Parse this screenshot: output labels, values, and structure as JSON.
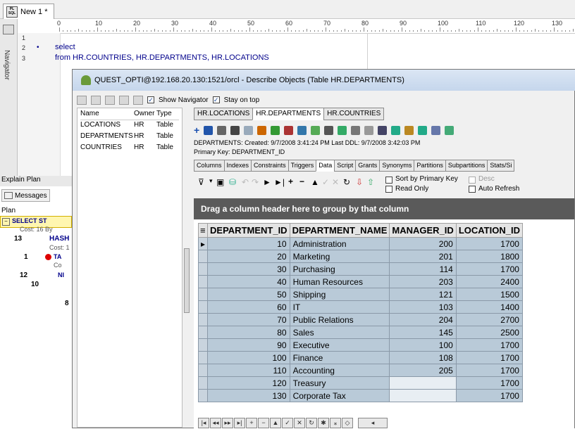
{
  "document_tab": {
    "title": "New 1 *",
    "icon": "plsql-file-icon"
  },
  "navigator_label": "Navigator",
  "ruler_numbers": [
    "0",
    "10",
    "20",
    "30",
    "40",
    "50",
    "60",
    "70",
    "80",
    "90",
    "100",
    "110",
    "120",
    "130"
  ],
  "editor": {
    "lines": [
      {
        "num": "1",
        "text": ""
      },
      {
        "num": "2",
        "text": "select"
      },
      {
        "num": "3",
        "text": "from HR.COUNTRIES, HR.DEPARTMENTS, HR.LOCATIONS"
      }
    ]
  },
  "explain_plan": {
    "title": "Explain Plan",
    "messages_tab": "Messages",
    "plan_label": "Plan",
    "rows": [
      "SELECT ST",
      "Cost: 16 By",
      "HASH",
      "Cost: 1",
      "TA",
      "Co",
      "NI"
    ],
    "numbers": [
      "13",
      "1",
      "12",
      "10",
      "8"
    ]
  },
  "dialog": {
    "title": "QUEST_OPTI@192.168.20.130:1521/orcl - Describe Objects (Table HR.DEPARTMENTS)",
    "show_navigator": "Show Navigator",
    "stay_on_top": "Stay on top",
    "object_list": {
      "headers": [
        "Name",
        "Owner",
        "Type"
      ],
      "rows": [
        [
          "LOCATIONS",
          "HR",
          "Table"
        ],
        [
          "DEPARTMENTS",
          "HR",
          "Table"
        ],
        [
          "COUNTRIES",
          "HR",
          "Table"
        ]
      ]
    },
    "object_tabs": [
      "HR.LOCATIONS",
      "HR.DEPARTMENTS",
      "HR.COUNTRIES"
    ],
    "active_object_tab": 1,
    "info_line": "DEPARTMENTS:  Created: 9/7/2008 3:41:24 PM   Last DDL: 9/7/2008 3:42:03 PM",
    "primary_key_line": "Primary Key:  DEPARTMENT_ID",
    "sub_tabs": [
      "Columns",
      "Indexes",
      "Constraints",
      "Triggers",
      "Data",
      "Script",
      "Grants",
      "Synonyms",
      "Partitions",
      "Subpartitions",
      "Stats/Si"
    ],
    "active_sub_tab": 4,
    "options": {
      "sort_by_pk": "Sort by Primary Key",
      "read_only": "Read Only",
      "desc": "Desc",
      "auto_refresh": "Auto Refresh"
    },
    "group_header": "Drag a column header here to group by that column",
    "grid": {
      "columns": [
        "DEPARTMENT_ID",
        "DEPARTMENT_NAME",
        "MANAGER_ID",
        "LOCATION_ID"
      ],
      "rows": [
        [
          "10",
          "Administration",
          "200",
          "1700"
        ],
        [
          "20",
          "Marketing",
          "201",
          "1800"
        ],
        [
          "30",
          "Purchasing",
          "114",
          "1700"
        ],
        [
          "40",
          "Human Resources",
          "203",
          "2400"
        ],
        [
          "50",
          "Shipping",
          "121",
          "1500"
        ],
        [
          "60",
          "IT",
          "103",
          "1400"
        ],
        [
          "70",
          "Public Relations",
          "204",
          "2700"
        ],
        [
          "80",
          "Sales",
          "145",
          "2500"
        ],
        [
          "90",
          "Executive",
          "100",
          "1700"
        ],
        [
          "100",
          "Finance",
          "108",
          "1700"
        ],
        [
          "110",
          "Accounting",
          "205",
          "1700"
        ],
        [
          "120",
          "Treasury",
          "",
          "1700"
        ],
        [
          "130",
          "Corporate Tax",
          "",
          "1700"
        ]
      ]
    }
  }
}
